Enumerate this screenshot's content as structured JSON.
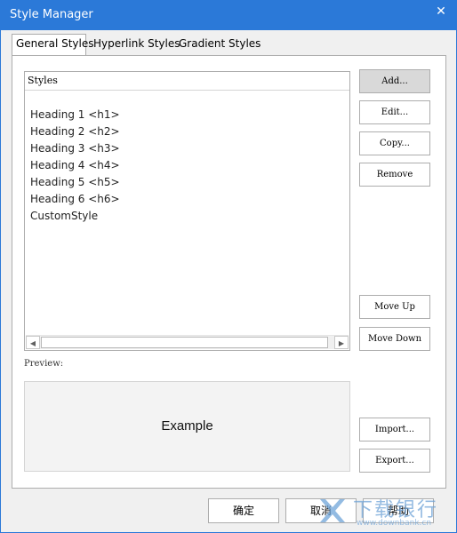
{
  "window": {
    "title": "Style Manager",
    "close_glyph": "✕"
  },
  "tabs": [
    {
      "label": "General Styles",
      "active": true
    },
    {
      "label": "Hyperlink Styles",
      "active": false
    },
    {
      "label": "Gradient Styles",
      "active": false
    }
  ],
  "styles_list": {
    "header": "Styles",
    "items": [
      "Heading 1 <h1>",
      "Heading 2 <h2>",
      "Heading 3 <h3>",
      "Heading 4 <h4>",
      "Heading 5 <h5>",
      "Heading 6 <h6>",
      "CustomStyle"
    ]
  },
  "buttons": {
    "add": "Add...",
    "edit": "Edit...",
    "copy": "Copy...",
    "remove": "Remove",
    "move_up": "Move Up",
    "move_down": "Move Down",
    "import": "Import...",
    "export": "Export..."
  },
  "preview": {
    "label": "Preview:",
    "example_text": "Example"
  },
  "footer": {
    "ok": "确定",
    "cancel": "取消",
    "help": "帮助"
  },
  "watermark": {
    "main": "下载银行",
    "sub": "www.downbank.cn"
  },
  "colors": {
    "titlebar": "#2b79d8",
    "watermark": "#6fa4d8"
  },
  "icons": {
    "close": "close-icon",
    "scroll_left": "chevron-left-icon",
    "scroll_right": "chevron-right-icon"
  }
}
